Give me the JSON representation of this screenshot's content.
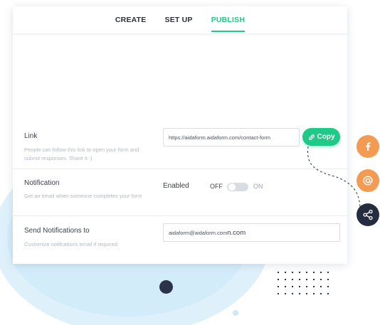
{
  "tabs": [
    {
      "label": "CREATE"
    },
    {
      "label": "SET UP"
    },
    {
      "label": "PUBLISH"
    }
  ],
  "link": {
    "title": "Link",
    "description": "People can follow this link to open your form and submit responses. Share it :)",
    "url": "https://aidaform.aidaform.com/contact-form",
    "copy_label": "Copy"
  },
  "notification": {
    "title": "Notification",
    "description": "Get an email when someone completes your form",
    "status_label": "Enabled",
    "toggle_off_label": "OFF",
    "toggle_on_label": "ON",
    "toggle_value": "OFF"
  },
  "send_notifications": {
    "title": "Send Notifications to",
    "description": "Customize notifcations email if required",
    "email": "aidaform@aidaform.com",
    "email_extra": "n.com"
  },
  "share": {
    "icons": [
      "facebook-icon",
      "at-sign-icon",
      "share-icon"
    ]
  },
  "colors": {
    "accent": "#1fc987",
    "orange": "#f39a53",
    "dark": "#252c40"
  }
}
